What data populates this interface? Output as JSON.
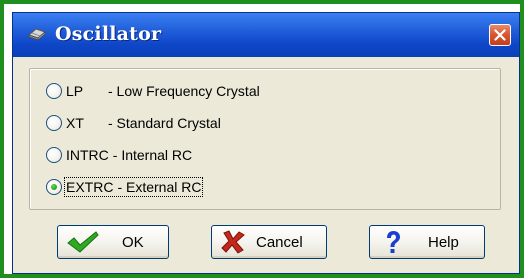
{
  "dialog": {
    "title": "Oscillator",
    "title_icon": "chip-icon",
    "close_icon": "close-icon"
  },
  "options": [
    {
      "code": "LP",
      "description": "- Low Frequency Crystal",
      "selected": false
    },
    {
      "code": "XT",
      "description": "- Standard Crystal",
      "selected": false
    },
    {
      "code": "INTRC",
      "description": "- Internal RC",
      "selected": false
    },
    {
      "code": "EXTRC",
      "description": "- External RC",
      "selected": true
    }
  ],
  "buttons": {
    "ok": {
      "label": "OK",
      "icon": "checkmark-icon"
    },
    "cancel": {
      "label": "Cancel",
      "icon": "x-icon"
    },
    "help": {
      "label": "Help",
      "icon": "question-icon"
    }
  },
  "colors": {
    "frame_border": "#1f8f1f",
    "titlebar": "#0f47c9",
    "dialog_bg": "#ece9d8",
    "ok_check": "#2eaa22",
    "cancel_x": "#c4281c",
    "help_q": "#1a3fd0"
  }
}
